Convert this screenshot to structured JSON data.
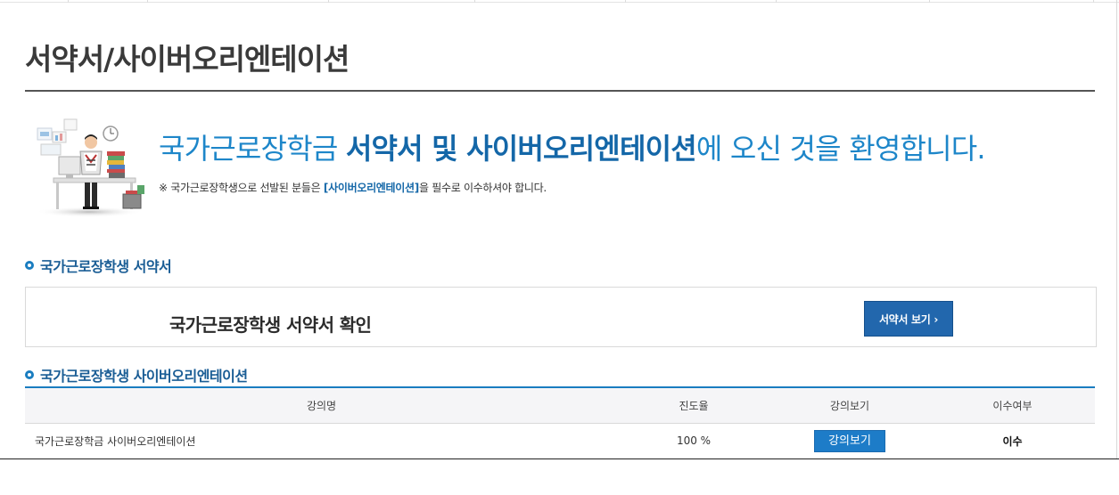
{
  "page": {
    "title": "서약서/사이버오리엔테이션"
  },
  "welcome": {
    "heading_pre": "국가근로장학금 ",
    "heading_bold": "서약서 및 사이버오리엔테이션",
    "heading_post": "에 오신 것을 환영합니다.",
    "note_pre": "※ 국가근로장학생으로 선발된 분들은 ",
    "note_highlight": "[사이버오리엔테이션]",
    "note_post": "을 필수로 이수하셔야 합니다."
  },
  "pledge_section": {
    "heading": "국가근로장학생 서약서",
    "confirm_text": "국가근로장학생 서약서 확인",
    "button_label": "서약서 보기 ›"
  },
  "orientation_section": {
    "heading": "국가근로장학생 사이버오리엔테이션",
    "columns": [
      "강의명",
      "진도율",
      "강의보기",
      "이수여부"
    ],
    "rows": [
      {
        "course": "국가근로장학금 사이버오리엔테이션",
        "progress": "100 %",
        "view_label": "강의보기",
        "status": "이수"
      }
    ]
  },
  "colors": {
    "accent_blue": "#1d86c9",
    "button_blue": "#2267ad",
    "section_blue": "#1a5d95"
  }
}
